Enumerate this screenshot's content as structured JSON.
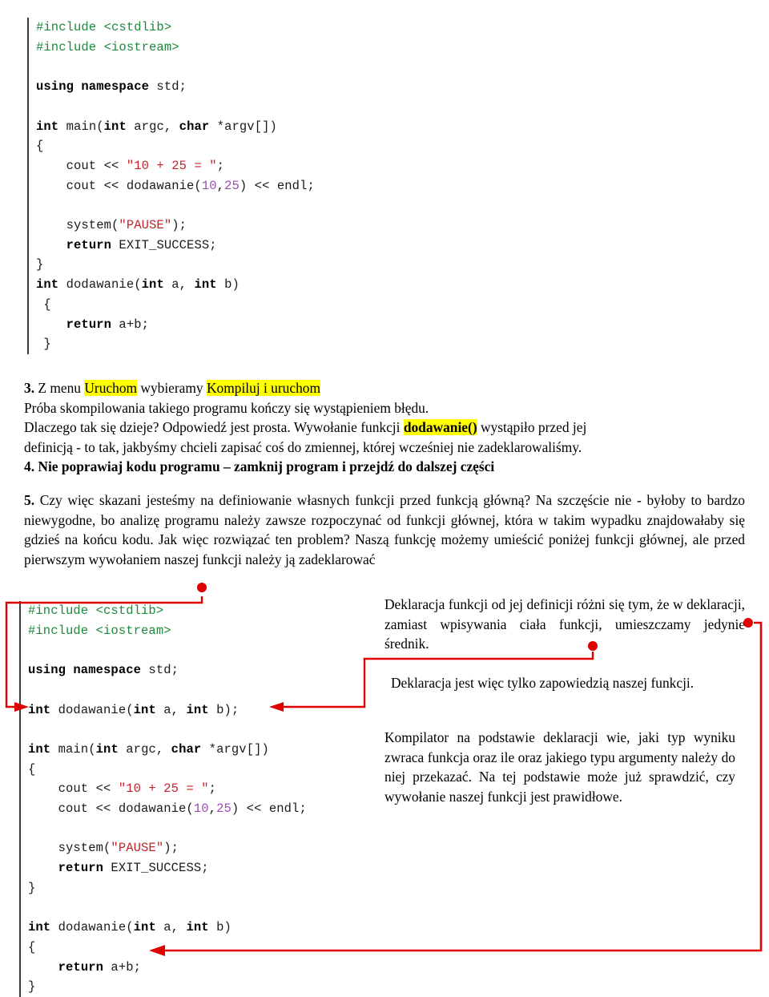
{
  "document": {
    "language": "pl",
    "title_context": "Kurs C++ — deklaracja funkcji"
  },
  "colors": {
    "highlight": "#ffff00",
    "annotation": "#e00000",
    "code_keyword": "#000000",
    "code_preprocessor": "#1c8a3c",
    "code_string": "#c4232a",
    "code_number": "#9a4fb5",
    "code_border": "#3a3a3a"
  },
  "code_block_1": {
    "name": "program bez deklaracji funkcji",
    "lines": [
      [
        {
          "t": "#include <cstdlib>",
          "c": "pp"
        }
      ],
      [
        {
          "t": "#include <iostream>",
          "c": "pp"
        }
      ],
      [
        {
          "t": "",
          "c": "pl"
        }
      ],
      [
        {
          "t": "using namespace",
          "c": "k"
        },
        {
          "t": " std;",
          "c": "pl"
        }
      ],
      [
        {
          "t": "",
          "c": "pl"
        }
      ],
      [
        {
          "t": "int",
          "c": "k"
        },
        {
          "t": " main(",
          "c": "pl"
        },
        {
          "t": "int",
          "c": "k"
        },
        {
          "t": " argc, ",
          "c": "pl"
        },
        {
          "t": "char",
          "c": "k"
        },
        {
          "t": " *argv[])",
          "c": "pl"
        }
      ],
      [
        {
          "t": "{",
          "c": "pl"
        }
      ],
      [
        {
          "t": "    cout << ",
          "c": "pl"
        },
        {
          "t": "\"10 + 25 = \"",
          "c": "str"
        },
        {
          "t": ";",
          "c": "pl"
        }
      ],
      [
        {
          "t": "    cout << dodawanie(",
          "c": "pl"
        },
        {
          "t": "10",
          "c": "num"
        },
        {
          "t": ",",
          "c": "pl"
        },
        {
          "t": "25",
          "c": "num"
        },
        {
          "t": ") << endl;",
          "c": "pl"
        }
      ],
      [
        {
          "t": "",
          "c": "pl"
        }
      ],
      [
        {
          "t": "    system(",
          "c": "pl"
        },
        {
          "t": "\"PAUSE\"",
          "c": "str"
        },
        {
          "t": ");",
          "c": "pl"
        }
      ],
      [
        {
          "t": "    ",
          "c": "pl"
        },
        {
          "t": "return",
          "c": "k"
        },
        {
          "t": " EXIT_SUCCESS;",
          "c": "pl"
        }
      ],
      [
        {
          "t": "}",
          "c": "pl"
        }
      ],
      [
        {
          "t": "int",
          "c": "k"
        },
        {
          "t": " dodawanie(",
          "c": "pl"
        },
        {
          "t": "int",
          "c": "k"
        },
        {
          "t": " a, ",
          "c": "pl"
        },
        {
          "t": "int",
          "c": "k"
        },
        {
          "t": " b)",
          "c": "pl"
        }
      ],
      [
        {
          "t": " {",
          "c": "pl"
        }
      ],
      [
        {
          "t": "    ",
          "c": "pl"
        },
        {
          "t": "return",
          "c": "k"
        },
        {
          "t": " a+b;",
          "c": "pl"
        }
      ],
      [
        {
          "t": " }",
          "c": "pl"
        }
      ]
    ]
  },
  "code_block_2": {
    "name": "program z deklaracja funkcji",
    "lines": [
      [
        {
          "t": "#include <cstdlib>",
          "c": "pp"
        }
      ],
      [
        {
          "t": "#include <iostream>",
          "c": "pp"
        }
      ],
      [
        {
          "t": "",
          "c": "pl"
        }
      ],
      [
        {
          "t": "using namespace",
          "c": "k"
        },
        {
          "t": " std;",
          "c": "pl"
        }
      ],
      [
        {
          "t": "",
          "c": "pl"
        }
      ],
      [
        {
          "t": "int",
          "c": "k"
        },
        {
          "t": " dodawanie(",
          "c": "pl"
        },
        {
          "t": "int",
          "c": "k"
        },
        {
          "t": " a, ",
          "c": "pl"
        },
        {
          "t": "int",
          "c": "k"
        },
        {
          "t": " b);",
          "c": "pl"
        }
      ],
      [
        {
          "t": "",
          "c": "pl"
        }
      ],
      [
        {
          "t": "int",
          "c": "k"
        },
        {
          "t": " main(",
          "c": "pl"
        },
        {
          "t": "int",
          "c": "k"
        },
        {
          "t": " argc, ",
          "c": "pl"
        },
        {
          "t": "char",
          "c": "k"
        },
        {
          "t": " *argv[])",
          "c": "pl"
        }
      ],
      [
        {
          "t": "{",
          "c": "pl"
        }
      ],
      [
        {
          "t": "    cout << ",
          "c": "pl"
        },
        {
          "t": "\"10 + 25 = \"",
          "c": "str"
        },
        {
          "t": ";",
          "c": "pl"
        }
      ],
      [
        {
          "t": "    cout << dodawanie(",
          "c": "pl"
        },
        {
          "t": "10",
          "c": "num"
        },
        {
          "t": ",",
          "c": "pl"
        },
        {
          "t": "25",
          "c": "num"
        },
        {
          "t": ") << endl;",
          "c": "pl"
        }
      ],
      [
        {
          "t": "",
          "c": "pl"
        }
      ],
      [
        {
          "t": "    system(",
          "c": "pl"
        },
        {
          "t": "\"PAUSE\"",
          "c": "str"
        },
        {
          "t": ");",
          "c": "pl"
        }
      ],
      [
        {
          "t": "    ",
          "c": "pl"
        },
        {
          "t": "return",
          "c": "k"
        },
        {
          "t": " EXIT_SUCCESS;",
          "c": "pl"
        }
      ],
      [
        {
          "t": "}",
          "c": "pl"
        }
      ],
      [
        {
          "t": "",
          "c": "pl"
        }
      ],
      [
        {
          "t": "int",
          "c": "k"
        },
        {
          "t": " dodawanie(",
          "c": "pl"
        },
        {
          "t": "int",
          "c": "k"
        },
        {
          "t": " a, ",
          "c": "pl"
        },
        {
          "t": "int",
          "c": "k"
        },
        {
          "t": " b)",
          "c": "pl"
        }
      ],
      [
        {
          "t": "{",
          "c": "pl"
        }
      ],
      [
        {
          "t": "    ",
          "c": "pl"
        },
        {
          "t": "return",
          "c": "k"
        },
        {
          "t": " a+b;",
          "c": "pl"
        }
      ],
      [
        {
          "t": "}",
          "c": "pl"
        }
      ]
    ]
  },
  "paragraphs": {
    "step3": {
      "number": "3.",
      "line1_a": " Z menu ",
      "line1_hl1": "Uruchom",
      "line1_b": " wybieramy ",
      "line1_hl2": "Kompiluj i uruchom",
      "line2": "Próba skompilowania takiego programu kończy się wystąpieniem błędu.",
      "line3_a": "Dlaczego tak się dzieje? Odpowiedź jest prosta. Wywołanie funkcji ",
      "line3_hl_bold": "dodawanie()",
      "line3_b": " wystąpiło przed jej",
      "line4": "definicją - to tak, jakbyśmy chcieli zapisać coś do zmiennej, której wcześniej nie zadeklarowaliśmy."
    },
    "step4": {
      "text": "4. Nie poprawiaj kodu programu – zamknij program i przejdź do dalszej części"
    },
    "step5": {
      "number": "5.",
      "text": " Czy więc skazani jesteśmy na definiowanie własnych funkcji przed funkcją główną? Na szczęście nie - byłoby to bardzo niewygodne, bo analizę programu należy zawsze rozpoczynać od funkcji głównej, która w takim wypadku znajdowałaby się gdzieś na końcu kodu. Jak więc rozwiązać ten problem? Naszą funkcję możemy umieścić poniżej funkcji głównej, ale przed pierwszym wywołaniem naszej funkcji należy ją zadeklarować"
    }
  },
  "notes": {
    "note1": "Deklaracja funkcji od jej definicji różni się tym, że w deklaracji, zamiast wpisywania ciała funkcji, umieszczamy jedynie średnik.",
    "note2": "Deklaracja jest więc tylko zapowiedzią naszej funkcji.",
    "note3": "Kompilator na podstawie deklaracji wie, jaki typ wyniku zwraca funkcja oraz ile oraz jakiego typu argumenty należy do niej przekazać. Na tej podstawie może już sprawdzić, czy wywołanie naszej funkcji jest prawidłowe."
  },
  "annotations": [
    {
      "name": "connector-declare-to-declaration",
      "from": "należy ją zadeklarować",
      "to": "int dodawanie(int a, int b);"
    },
    {
      "name": "connector-semicolon-note",
      "from": "umieszczamy jedynie średnik.",
      "to": "; w deklaracji"
    },
    {
      "name": "connector-body-note",
      "from": "ciała funkcji,",
      "to": "return a+b;"
    }
  ]
}
